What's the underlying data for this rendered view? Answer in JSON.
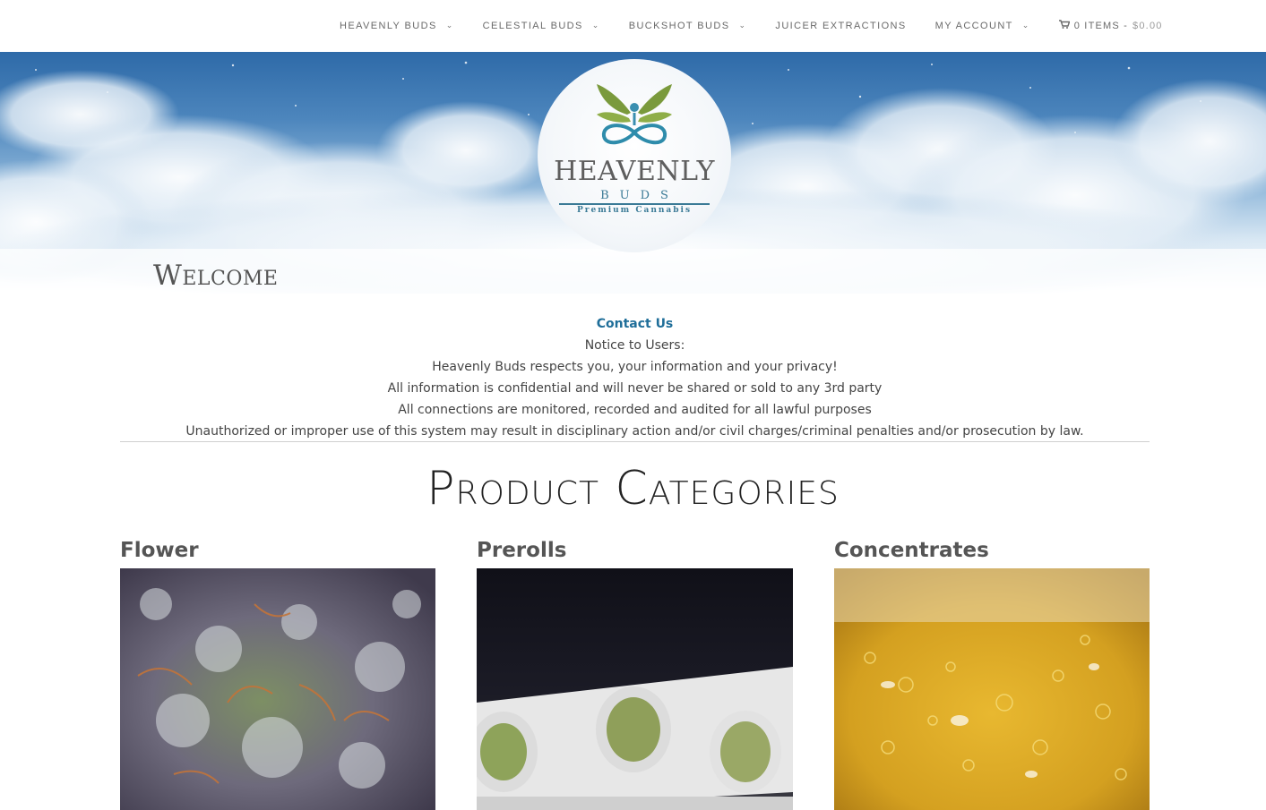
{
  "nav": {
    "items": [
      {
        "label": "HEAVENLY BUDS",
        "dropdown": true
      },
      {
        "label": "CELESTIAL BUDS",
        "dropdown": true
      },
      {
        "label": "BUCKSHOT BUDS",
        "dropdown": true
      },
      {
        "label": "JUICER EXTRACTIONS",
        "dropdown": false
      },
      {
        "label": "MY ACCOUNT",
        "dropdown": true
      }
    ],
    "cart": {
      "items": "0 ITEMS -",
      "total": "$0.00",
      "icon": "cart-icon"
    }
  },
  "hero": {
    "logo": {
      "word1": "HEAVENLY",
      "word2": "BUDS",
      "tagline": "Premium Cannabis"
    }
  },
  "welcome": "Welcome",
  "notice": {
    "contact_link": "Contact Us",
    "lines": [
      "Notice to Users:",
      "Heavenly Buds respects you, your information and your privacy!",
      "All information is confidential and will never be shared or sold to any 3rd party",
      "All connections are monitored, recorded and audited for all lawful purposes",
      "Unauthorized or improper use of this system may result in disciplinary action and/or civil charges/criminal penalties and/or prosecution by law."
    ]
  },
  "categories": {
    "title": "Product Categories",
    "items": [
      {
        "label": "Flower"
      },
      {
        "label": "Prerolls"
      },
      {
        "label": "Concentrates"
      }
    ]
  },
  "colors": {
    "accent": "#1f6e99",
    "nav_text": "#6a6a6a",
    "heading": "#555555"
  }
}
